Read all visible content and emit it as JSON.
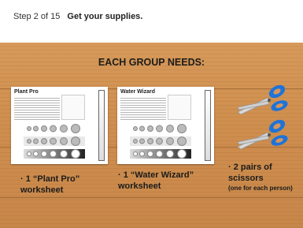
{
  "header": {
    "step": "Step 2 of 15",
    "title": "Get your supplies."
  },
  "board": {
    "heading": "EACH GROUP NEEDS:",
    "items": [
      {
        "bullet": "·",
        "label": "1 “Plant Pro” worksheet"
      },
      {
        "bullet": "·",
        "label": "1 “Water Wizard” worksheet"
      },
      {
        "bullet": "·",
        "label": "2 pairs of scissors",
        "note": "(one for each person)"
      }
    ],
    "sheets": [
      {
        "title": "Plant Pro"
      },
      {
        "title": "Water Wizard"
      }
    ]
  },
  "colors": {
    "wood": "#cf8f4f",
    "scissors_blue": "#1e73d8"
  },
  "icons": [
    "scissors-icon",
    "scissors-icon"
  ]
}
